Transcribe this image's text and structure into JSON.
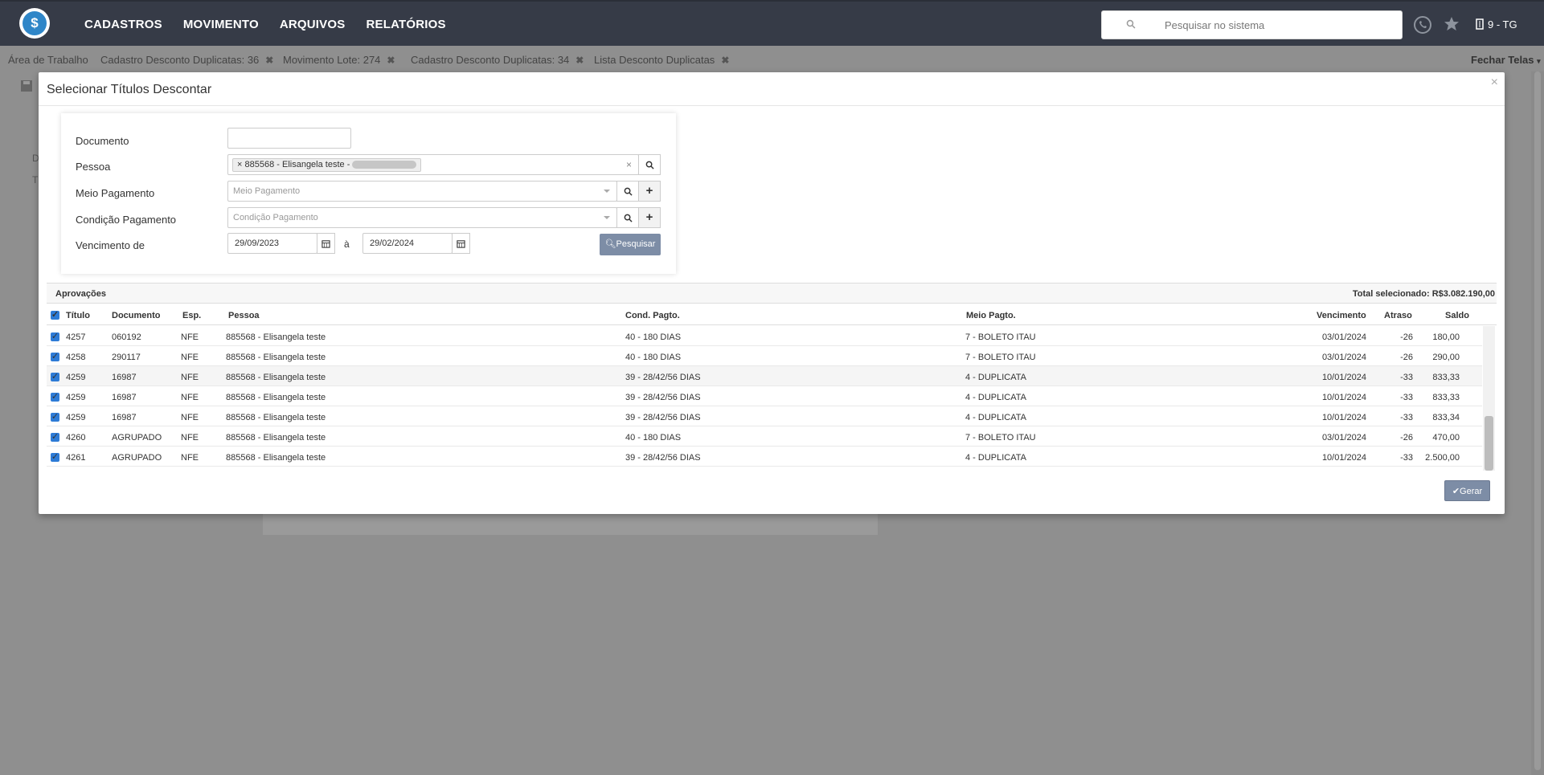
{
  "nav": {
    "items": [
      "CADASTROS",
      "MOVIMENTO",
      "ARQUIVOS",
      "RELATÓRIOS"
    ]
  },
  "search": {
    "placeholder": "Pesquisar no sistema"
  },
  "user": "9 - TG",
  "logo_symbol": "$",
  "tabs": [
    {
      "label": "Área de Trabalho",
      "closable": false
    },
    {
      "label": "Cadastro Desconto Duplicatas: 36",
      "closable": true
    },
    {
      "label": "Movimento Lote: 274",
      "closable": true
    },
    {
      "label": "Cadastro Desconto Duplicatas: 34",
      "closable": true
    },
    {
      "label": "Lista Desconto Duplicatas",
      "closable": true
    }
  ],
  "tab_close": "✖",
  "fechar_telas": "Fechar Telas",
  "modal": {
    "title": "Selecionar Títulos Descontar",
    "close": "×"
  },
  "form": {
    "documento_label": "Documento",
    "documento_value": "",
    "pessoa_label": "Pessoa",
    "pessoa_tag": "885568 - Elisangela teste -",
    "meio_label": "Meio Pagamento",
    "meio_placeholder": "Meio Pagamento",
    "cond_label": "Condição Pagamento",
    "cond_placeholder": "Condição Pagamento",
    "venc_label": "Vencimento de",
    "venc_de": "29/09/2023",
    "venc_sep": "à",
    "venc_ate": "29/02/2024",
    "pesquisar": "Pesquisar"
  },
  "grid": {
    "section": "Aprovações",
    "total": "Total selecionado: R$3.082.190,00",
    "columns": [
      "Título",
      "Documento",
      "Esp.",
      "Pessoa",
      "Cond. Pagto.",
      "Meio Pagto.",
      "Vencimento",
      "Atraso",
      "Saldo"
    ],
    "rows": [
      [
        "4257",
        "060192",
        "NFE",
        "885568 - Elisangela teste",
        "40 - 180 DIAS",
        "7 - BOLETO ITAU",
        "03/01/2024",
        "-26",
        "180,00"
      ],
      [
        "4258",
        "290117",
        "NFE",
        "885568 - Elisangela teste",
        "40 - 180 DIAS",
        "7 - BOLETO ITAU",
        "03/01/2024",
        "-26",
        "290,00"
      ],
      [
        "4259",
        "16987",
        "NFE",
        "885568 - Elisangela teste",
        "39 - 28/42/56 DIAS",
        "4 - DUPLICATA",
        "10/01/2024",
        "-33",
        "833,33"
      ],
      [
        "4259",
        "16987",
        "NFE",
        "885568 - Elisangela teste",
        "39 - 28/42/56 DIAS",
        "4 - DUPLICATA",
        "10/01/2024",
        "-33",
        "833,33"
      ],
      [
        "4259",
        "16987",
        "NFE",
        "885568 - Elisangela teste",
        "39 - 28/42/56 DIAS",
        "4 - DUPLICATA",
        "10/01/2024",
        "-33",
        "833,34"
      ],
      [
        "4260",
        "AGRUPADO",
        "NFE",
        "885568 - Elisangela teste",
        "40 - 180 DIAS",
        "7 - BOLETO ITAU",
        "03/01/2024",
        "-26",
        "470,00"
      ],
      [
        "4261",
        "AGRUPADO",
        "NFE",
        "885568 - Elisangela teste",
        "39 - 28/42/56 DIAS",
        "4 - DUPLICATA",
        "10/01/2024",
        "-33",
        "2.500,00"
      ]
    ],
    "gerar": "Gerar"
  },
  "background": {
    "letters": [
      "D",
      "T"
    ]
  },
  "colors": {
    "topbar": "#363b47",
    "accent": "#2f86c8",
    "button": "#7d8da6",
    "checkbox": "#2d7bd6"
  }
}
